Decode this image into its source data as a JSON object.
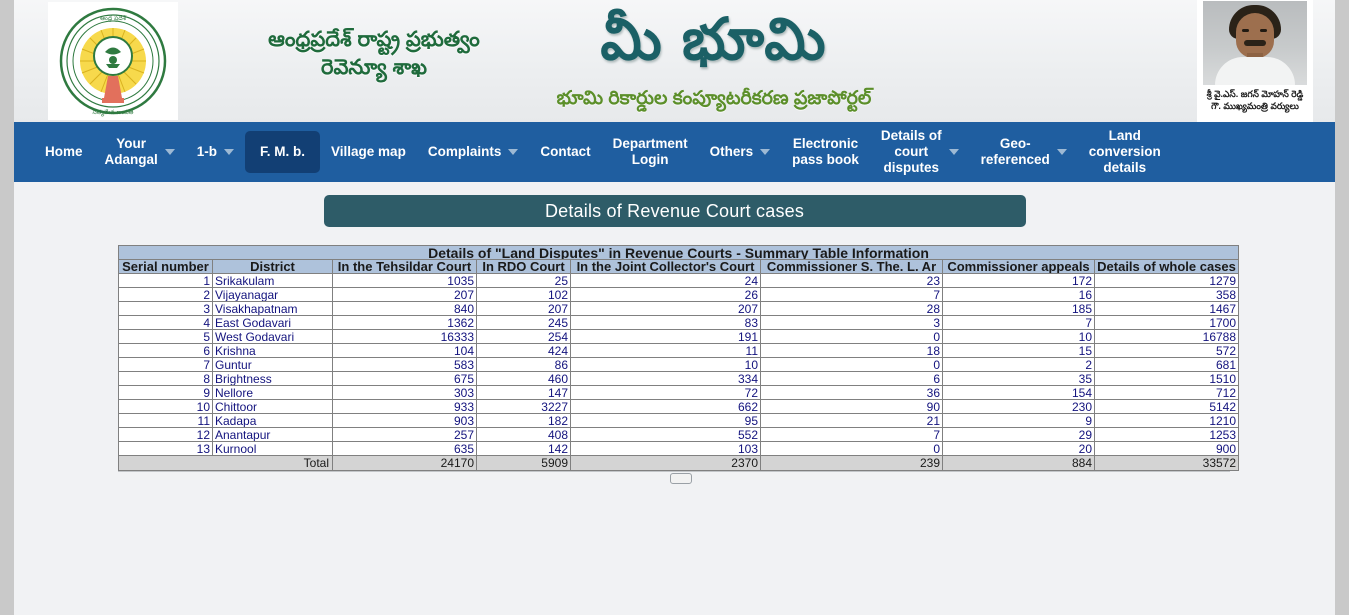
{
  "header": {
    "emblem_alt": "andhra-pradesh-state-emblem",
    "gov_line1": "ఆంధ్రప్రదేశ్ రాష్ట్ర ప్రభుత్వం",
    "gov_line2": "రెవెన్యూ శాఖ",
    "portal_title": "మీ భూమి",
    "portal_subtitle": "భూమి రికార్డుల కంప్యూటరీకరణ ప్రజాపోర్టల్",
    "cm_caption_line1": "శ్రీ వై.ఎస్. జగన్ మోహన్ రెడ్డి",
    "cm_caption_line2": "గౌ. ముఖ్యమంత్రి వర్యులు",
    "colors": {
      "nav_bg": "#1f5ea0",
      "nav_active_bg": "#123f74",
      "title_bar_bg": "#2e5c68",
      "table_header_bg": "#aec2db",
      "total_row_bg": "#d4d4d4",
      "link_blue": "#13137e"
    }
  },
  "nav": {
    "items": [
      {
        "label": "Home",
        "has_caret": false,
        "active": false
      },
      {
        "label": "Your\nAdangal",
        "has_caret": true,
        "active": false
      },
      {
        "label": "1-b",
        "has_caret": true,
        "active": false
      },
      {
        "label": "F. M. b.",
        "has_caret": false,
        "active": true
      },
      {
        "label": "Village map",
        "has_caret": false,
        "active": false
      },
      {
        "label": "Complaints",
        "has_caret": true,
        "active": false
      },
      {
        "label": "Contact",
        "has_caret": false,
        "active": false
      },
      {
        "label": "Department\nLogin",
        "has_caret": false,
        "active": false
      },
      {
        "label": "Others",
        "has_caret": true,
        "active": false
      },
      {
        "label": "Electronic\npass book",
        "has_caret": false,
        "active": false
      },
      {
        "label": "Details of\ncourt\ndisputes",
        "has_caret": true,
        "active": false
      },
      {
        "label": "Geo-\nreferenced",
        "has_caret": true,
        "active": false
      },
      {
        "label": "Land\nconversion\ndetails",
        "has_caret": false,
        "active": false
      }
    ]
  },
  "page_title": "Details of Revenue Court cases",
  "table": {
    "caption": "Details of \"Land Disputes\" in Revenue Courts - Summary Table Information",
    "columns": [
      "Serial number",
      "District",
      "In the Tehsildar Court",
      "In RDO Court",
      "In the Joint Collector's Court",
      "Commissioner S. The. L. Ar",
      "Commissioner appeals",
      "Details of whole cases"
    ],
    "rows": [
      {
        "sno": "1",
        "district": "Srikakulam",
        "tehsildar": "1035",
        "rdo": "25",
        "joint_collector": "24",
        "commissioner_sthelar": "23",
        "commissioner_appeals": "172",
        "whole": "1279"
      },
      {
        "sno": "2",
        "district": "Vijayanagar",
        "tehsildar": "207",
        "rdo": "102",
        "joint_collector": "26",
        "commissioner_sthelar": "7",
        "commissioner_appeals": "16",
        "whole": "358"
      },
      {
        "sno": "3",
        "district": "Visakhapatnam",
        "tehsildar": "840",
        "rdo": "207",
        "joint_collector": "207",
        "commissioner_sthelar": "28",
        "commissioner_appeals": "185",
        "whole": "1467"
      },
      {
        "sno": "4",
        "district": "East Godavari",
        "tehsildar": "1362",
        "rdo": "245",
        "joint_collector": "83",
        "commissioner_sthelar": "3",
        "commissioner_appeals": "7",
        "whole": "1700"
      },
      {
        "sno": "5",
        "district": "West Godavari",
        "tehsildar": "16333",
        "rdo": "254",
        "joint_collector": "191",
        "commissioner_sthelar": "0",
        "commissioner_appeals": "10",
        "whole": "16788"
      },
      {
        "sno": "6",
        "district": "Krishna",
        "tehsildar": "104",
        "rdo": "424",
        "joint_collector": "11",
        "commissioner_sthelar": "18",
        "commissioner_appeals": "15",
        "whole": "572"
      },
      {
        "sno": "7",
        "district": "Guntur",
        "tehsildar": "583",
        "rdo": "86",
        "joint_collector": "10",
        "commissioner_sthelar": "0",
        "commissioner_appeals": "2",
        "whole": "681"
      },
      {
        "sno": "8",
        "district": "Brightness",
        "tehsildar": "675",
        "rdo": "460",
        "joint_collector": "334",
        "commissioner_sthelar": "6",
        "commissioner_appeals": "35",
        "whole": "1510"
      },
      {
        "sno": "9",
        "district": "Nellore",
        "tehsildar": "303",
        "rdo": "147",
        "joint_collector": "72",
        "commissioner_sthelar": "36",
        "commissioner_appeals": "154",
        "whole": "712"
      },
      {
        "sno": "10",
        "district": "Chittoor",
        "tehsildar": "933",
        "rdo": "3227",
        "joint_collector": "662",
        "commissioner_sthelar": "90",
        "commissioner_appeals": "230",
        "whole": "5142"
      },
      {
        "sno": "11",
        "district": "Kadapa",
        "tehsildar": "903",
        "rdo": "182",
        "joint_collector": "95",
        "commissioner_sthelar": "21",
        "commissioner_appeals": "9",
        "whole": "1210"
      },
      {
        "sno": "12",
        "district": "Anantapur",
        "tehsildar": "257",
        "rdo": "408",
        "joint_collector": "552",
        "commissioner_sthelar": "7",
        "commissioner_appeals": "29",
        "whole": "1253"
      },
      {
        "sno": "13",
        "district": "Kurnool",
        "tehsildar": "635",
        "rdo": "142",
        "joint_collector": "103",
        "commissioner_sthelar": "0",
        "commissioner_appeals": "20",
        "whole": "900"
      }
    ],
    "total": {
      "label": "Total",
      "tehsildar": "24170",
      "rdo": "5909",
      "joint_collector": "2370",
      "commissioner_sthelar": "239",
      "commissioner_appeals": "884",
      "whole": "33572"
    }
  }
}
